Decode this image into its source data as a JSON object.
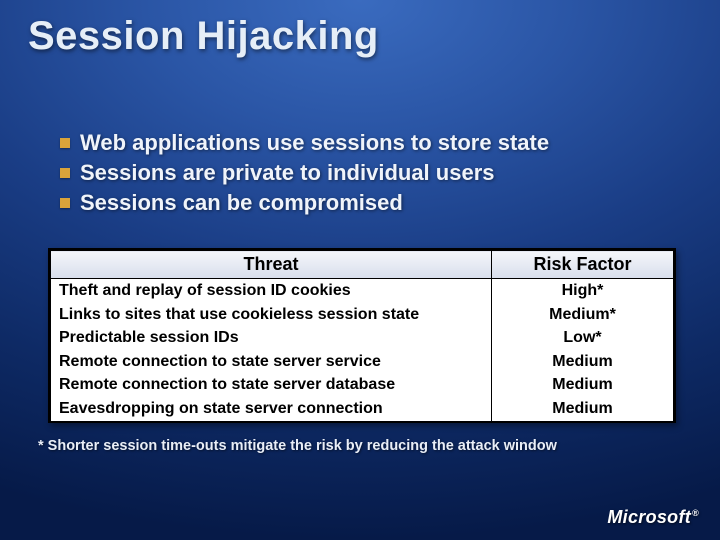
{
  "title": "Session Hijacking",
  "bullets": [
    "Web applications use sessions to store state",
    "Sessions are private to individual users",
    "Sessions can be compromised"
  ],
  "table": {
    "headers": {
      "threat": "Threat",
      "risk": "Risk Factor"
    },
    "rows": [
      {
        "threat": "Theft and replay of session ID cookies",
        "risk": "High*"
      },
      {
        "threat": "Links to sites that use cookieless session state",
        "risk": "Medium*"
      },
      {
        "threat": "Predictable session IDs",
        "risk": "Low*"
      },
      {
        "threat": "Remote connection to state server service",
        "risk": "Medium"
      },
      {
        "threat": "Remote connection to state server database",
        "risk": "Medium"
      },
      {
        "threat": "Eavesdropping on state server connection",
        "risk": "Medium"
      }
    ]
  },
  "footnote": "* Shorter session time-outs mitigate the risk by reducing the attack window",
  "logo": {
    "text": "Microsoft",
    "reg": "®"
  }
}
